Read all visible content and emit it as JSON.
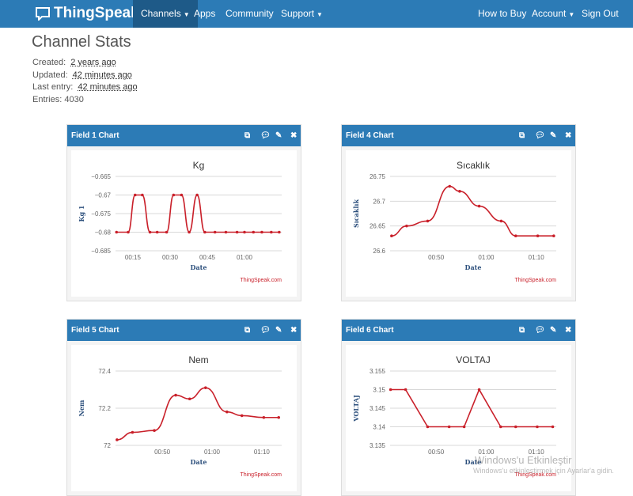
{
  "nav": {
    "brand": "ThingSpeak",
    "tm": "™",
    "items": [
      {
        "label": "Channels",
        "caret": true,
        "active": true
      },
      {
        "label": "Apps"
      },
      {
        "label": "Community"
      },
      {
        "label": "Support",
        "caret": true
      }
    ],
    "right": [
      {
        "label": "How to Buy"
      },
      {
        "label": "Account",
        "caret": true
      },
      {
        "label": "Sign Out"
      }
    ]
  },
  "page": {
    "title": "Channel Stats",
    "created_label": "Created:",
    "created": "2 years ago",
    "updated_label": "Updated:",
    "updated": "42 minutes ago",
    "last_label": "Last entry:",
    "last": "42 minutes ago",
    "entries_label": "Entries:",
    "entries": "4030"
  },
  "watermark": {
    "line1": "Windows'u Etkinleştir",
    "line2": "Windows'u etkinleştirmek için Ayarlar'a gidin."
  },
  "colors": {
    "nav": "#2c7bb6",
    "line": "#c9202a"
  },
  "chart_data": [
    {
      "panel_title": "Field 1 Chart",
      "type": "line",
      "smooth": true,
      "title": "Kg",
      "xlabel": "Date",
      "ylabel": "Kg 1",
      "credit": "ThingSpeak.com",
      "xlim": [
        8,
        75
      ],
      "ylim": [
        -0.685,
        -0.665
      ],
      "yticks": [
        -0.665,
        -0.67,
        -0.675,
        -0.68,
        -0.685
      ],
      "ytick_labels": [
        "−0.665",
        "−0.67",
        "−0.675",
        "−0.68",
        "−0.685"
      ],
      "xticks": [
        15,
        30,
        45,
        60
      ],
      "xtick_labels": [
        "00:15",
        "00:30",
        "00:45",
        "01:00"
      ],
      "x": [
        8.4,
        13.1,
        15.9,
        18.8,
        21.9,
        24.8,
        28.6,
        31.4,
        34.6,
        37.7,
        40.9,
        44,
        48.1,
        52.5,
        57,
        60,
        63.6,
        67,
        70.8,
        74
      ],
      "y": [
        -0.68,
        -0.68,
        -0.67,
        -0.67,
        -0.68,
        -0.68,
        -0.68,
        -0.67,
        -0.67,
        -0.68,
        -0.67,
        -0.68,
        -0.68,
        -0.68,
        -0.68,
        -0.68,
        -0.68,
        -0.68,
        -0.68,
        -0.68
      ]
    },
    {
      "panel_title": "Field 4 Chart",
      "type": "line",
      "smooth": true,
      "title": "Sıcaklık",
      "xlabel": "Date",
      "ylabel": "Sıcaklık",
      "credit": "ThingSpeak.com",
      "xlim": [
        40.8,
        74
      ],
      "ylim": [
        26.6,
        26.75
      ],
      "yticks": [
        26.75,
        26.7,
        26.65,
        26.6
      ],
      "ytick_labels": [
        "26.75",
        "26.7",
        "26.65",
        "26.6"
      ],
      "xticks": [
        50,
        60,
        70
      ],
      "xtick_labels": [
        "00:50",
        "01:00",
        "01:10"
      ],
      "x": [
        41.1,
        44.1,
        48.3,
        52.7,
        54.7,
        58.6,
        63,
        65.9,
        70.3,
        73.5
      ],
      "y": [
        26.63,
        26.65,
        26.66,
        26.73,
        26.72,
        26.69,
        26.66,
        26.63,
        26.63,
        26.63
      ]
    },
    {
      "panel_title": "Field 5 Chart",
      "type": "line",
      "smooth": true,
      "title": "Nem",
      "xlabel": "Date",
      "ylabel": "Nem",
      "credit": "ThingSpeak.com",
      "xlim": [
        40.6,
        74
      ],
      "ylim": [
        72,
        72.4
      ],
      "yticks": [
        72.4,
        72.2,
        72
      ],
      "ytick_labels": [
        "72.4",
        "72.2",
        "72"
      ],
      "xticks": [
        50,
        60,
        70
      ],
      "xtick_labels": [
        "00:50",
        "01:00",
        "01:10"
      ],
      "x": [
        40.9,
        44,
        48.4,
        52.7,
        55.5,
        58.7,
        63,
        66,
        70.4,
        73.4
      ],
      "y": [
        72.03,
        72.07,
        72.08,
        72.27,
        72.25,
        72.31,
        72.18,
        72.16,
        72.15,
        72.15
      ]
    },
    {
      "panel_title": "Field 6 Chart",
      "type": "line",
      "smooth": false,
      "title": "VOLTAJ",
      "xlabel": "Date",
      "ylabel": "VOLTAJ",
      "credit": "ThingSpeak.com",
      "xlim": [
        40.8,
        74
      ],
      "ylim": [
        3.135,
        3.155
      ],
      "yticks": [
        3.155,
        3.15,
        3.145,
        3.14,
        3.135
      ],
      "ytick_labels": [
        "3.155",
        "3.15",
        "3.145",
        "3.14",
        "3.135"
      ],
      "xticks": [
        50,
        60,
        70
      ],
      "xtick_labels": [
        "00:50",
        "01:00",
        "01:10"
      ],
      "x": [
        40.9,
        43.9,
        48.3,
        52.6,
        55.6,
        58.6,
        62.9,
        65.9,
        70.2,
        73.3
      ],
      "y": [
        3.15,
        3.15,
        3.14,
        3.14,
        3.14,
        3.15,
        3.14,
        3.14,
        3.14,
        3.14
      ]
    }
  ]
}
